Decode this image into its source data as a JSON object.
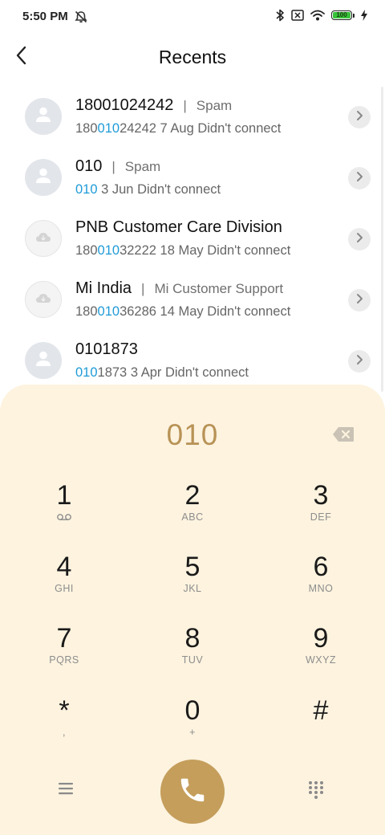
{
  "status": {
    "time": "5:50 PM",
    "battery": "100"
  },
  "header": {
    "title": "Recents"
  },
  "recents": [
    {
      "name": "18001024242",
      "label": "Spam",
      "number_prefix": "180",
      "number_match": "010",
      "number_suffix": "24242",
      "info": "7 Aug Didn't connect",
      "avatar": "person"
    },
    {
      "name": "010",
      "label": "Spam",
      "number_prefix": "",
      "number_match": "010",
      "number_suffix": "",
      "info": "3 Jun Didn't connect",
      "avatar": "person"
    },
    {
      "name": "PNB Customer Care Division",
      "label": "",
      "number_prefix": "180",
      "number_match": "010",
      "number_suffix": "32222",
      "info": "18 May Didn't connect",
      "avatar": "cloud"
    },
    {
      "name": "Mi India",
      "label": "Mi Customer Support",
      "number_prefix": "180",
      "number_match": "010",
      "number_suffix": "36286",
      "info": "14 May Didn't connect",
      "avatar": "cloud"
    },
    {
      "name": "0101873",
      "label": "",
      "number_prefix": "",
      "number_match": "010",
      "number_suffix": "1873",
      "info": "3 Apr Didn't connect",
      "avatar": "person"
    }
  ],
  "dialpad": {
    "input": "010",
    "keys": [
      {
        "digit": "1",
        "sub": ""
      },
      {
        "digit": "2",
        "sub": "ABC"
      },
      {
        "digit": "3",
        "sub": "DEF"
      },
      {
        "digit": "4",
        "sub": "GHI"
      },
      {
        "digit": "5",
        "sub": "JKL"
      },
      {
        "digit": "6",
        "sub": "MNO"
      },
      {
        "digit": "7",
        "sub": "PQRS"
      },
      {
        "digit": "8",
        "sub": "TUV"
      },
      {
        "digit": "9",
        "sub": "WXYZ"
      },
      {
        "digit": "*",
        "sub": ","
      },
      {
        "digit": "0",
        "sub": "+"
      },
      {
        "digit": "#",
        "sub": ""
      }
    ]
  },
  "icons": {
    "status_left": "alarm-off-icon",
    "bluetooth": "bluetooth-icon",
    "sim": "no-sim-icon",
    "wifi": "wifi-icon",
    "charging": "charging-bolt-icon",
    "back": "chevron-left-icon",
    "info": "chevron-right-icon",
    "backspace": "backspace-icon",
    "menu": "hamburger-menu-icon",
    "call": "phone-icon",
    "keypad": "dialpad-grid-icon"
  },
  "colors": {
    "accent": "#c59e5c",
    "dialpad_bg": "#fdf3df",
    "dial_text": "#b89256",
    "match_highlight": "#1e9bd7"
  }
}
